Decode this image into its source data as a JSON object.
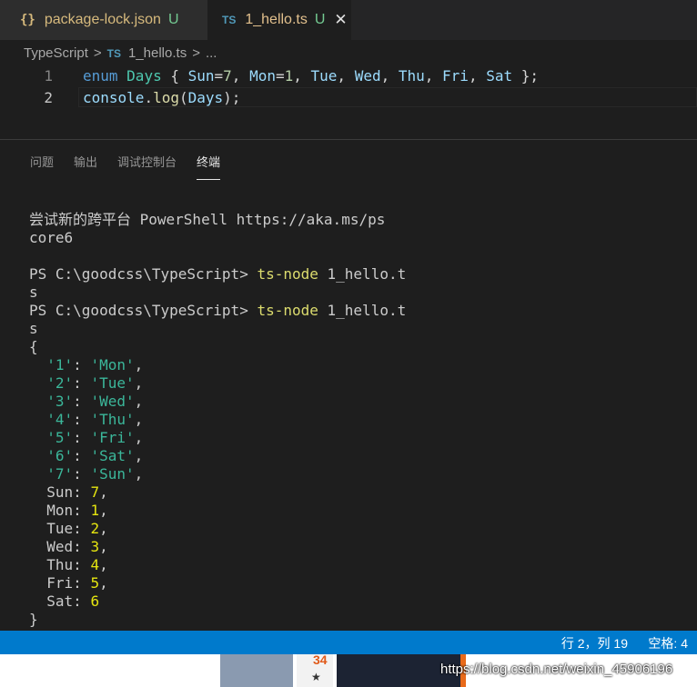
{
  "tabs": [
    {
      "icon_text": "{}",
      "icon": "json-icon",
      "label": "package-lock.json",
      "status": "U"
    },
    {
      "icon_text": "TS",
      "icon": "typescript-icon",
      "label": "1_hello.ts",
      "status": "U",
      "close": "✕"
    }
  ],
  "breadcrumb": {
    "folder": "TypeScript",
    "sep": ">",
    "ts_icon": "TS",
    "file": "1_hello.ts",
    "more": "..."
  },
  "editor": {
    "lines": [
      {
        "number": "1",
        "tokens": [
          {
            "t": "enum",
            "c": "kw"
          },
          {
            "t": " ",
            "c": "pn"
          },
          {
            "t": "Days",
            "c": "ty"
          },
          {
            "t": " { ",
            "c": "pn"
          },
          {
            "t": "Sun",
            "c": "vr"
          },
          {
            "t": "=",
            "c": "pn"
          },
          {
            "t": "7",
            "c": "nm"
          },
          {
            "t": ", ",
            "c": "pn"
          },
          {
            "t": "Mon",
            "c": "vr"
          },
          {
            "t": "=",
            "c": "pn"
          },
          {
            "t": "1",
            "c": "nm"
          },
          {
            "t": ", ",
            "c": "pn"
          },
          {
            "t": "Tue",
            "c": "vr"
          },
          {
            "t": ", ",
            "c": "pn"
          },
          {
            "t": "Wed",
            "c": "vr"
          },
          {
            "t": ", ",
            "c": "pn"
          },
          {
            "t": "Thu",
            "c": "vr"
          },
          {
            "t": ", ",
            "c": "pn"
          },
          {
            "t": "Fri",
            "c": "vr"
          },
          {
            "t": ", ",
            "c": "pn"
          },
          {
            "t": "Sat",
            "c": "vr"
          },
          {
            "t": " };",
            "c": "pn"
          }
        ]
      },
      {
        "number": "2",
        "tokens": [
          {
            "t": "console",
            "c": "vr"
          },
          {
            "t": ".",
            "c": "pn"
          },
          {
            "t": "log",
            "c": "fn"
          },
          {
            "t": "(",
            "c": "pn"
          },
          {
            "t": "Days",
            "c": "vr"
          },
          {
            "t": ");",
            "c": "pn"
          }
        ]
      }
    ]
  },
  "panel_tabs": [
    "问题",
    "输出",
    "调试控制台",
    "终端"
  ],
  "panel_active_tab": "终端",
  "terminal": {
    "lines": [
      [
        {
          "t": "尝试新的跨平台 PowerShell https://aka.ms/ps",
          "c": ""
        }
      ],
      [
        {
          "t": "core6",
          "c": ""
        }
      ],
      [
        {
          "t": "",
          "c": ""
        }
      ],
      [
        {
          "t": "PS C:\\goodcss\\TypeScript> ",
          "c": ""
        },
        {
          "t": "ts-node",
          "c": "cmd"
        },
        {
          "t": " 1_hello.t",
          "c": ""
        }
      ],
      [
        {
          "t": "s",
          "c": ""
        }
      ],
      [
        {
          "t": "PS C:\\goodcss\\TypeScript> ",
          "c": ""
        },
        {
          "t": "ts-node",
          "c": "cmd"
        },
        {
          "t": " 1_hello.t",
          "c": ""
        }
      ],
      [
        {
          "t": "s",
          "c": ""
        }
      ],
      [
        {
          "t": "{",
          "c": ""
        }
      ],
      [
        {
          "t": "  ",
          "c": ""
        },
        {
          "t": "'1'",
          "c": "str"
        },
        {
          "t": ": ",
          "c": ""
        },
        {
          "t": "'Mon'",
          "c": "str"
        },
        {
          "t": ",",
          "c": ""
        }
      ],
      [
        {
          "t": "  ",
          "c": ""
        },
        {
          "t": "'2'",
          "c": "str"
        },
        {
          "t": ": ",
          "c": ""
        },
        {
          "t": "'Tue'",
          "c": "str"
        },
        {
          "t": ",",
          "c": ""
        }
      ],
      [
        {
          "t": "  ",
          "c": ""
        },
        {
          "t": "'3'",
          "c": "str"
        },
        {
          "t": ": ",
          "c": ""
        },
        {
          "t": "'Wed'",
          "c": "str"
        },
        {
          "t": ",",
          "c": ""
        }
      ],
      [
        {
          "t": "  ",
          "c": ""
        },
        {
          "t": "'4'",
          "c": "str"
        },
        {
          "t": ": ",
          "c": ""
        },
        {
          "t": "'Thu'",
          "c": "str"
        },
        {
          "t": ",",
          "c": ""
        }
      ],
      [
        {
          "t": "  ",
          "c": ""
        },
        {
          "t": "'5'",
          "c": "str"
        },
        {
          "t": ": ",
          "c": ""
        },
        {
          "t": "'Fri'",
          "c": "str"
        },
        {
          "t": ",",
          "c": ""
        }
      ],
      [
        {
          "t": "  ",
          "c": ""
        },
        {
          "t": "'6'",
          "c": "str"
        },
        {
          "t": ": ",
          "c": ""
        },
        {
          "t": "'Sat'",
          "c": "str"
        },
        {
          "t": ",",
          "c": ""
        }
      ],
      [
        {
          "t": "  ",
          "c": ""
        },
        {
          "t": "'7'",
          "c": "str"
        },
        {
          "t": ": ",
          "c": ""
        },
        {
          "t": "'Sun'",
          "c": "str"
        },
        {
          "t": ",",
          "c": ""
        }
      ],
      [
        {
          "t": "  Sun: ",
          "c": ""
        },
        {
          "t": "7",
          "c": "num"
        },
        {
          "t": ",",
          "c": ""
        }
      ],
      [
        {
          "t": "  Mon: ",
          "c": ""
        },
        {
          "t": "1",
          "c": "num"
        },
        {
          "t": ",",
          "c": ""
        }
      ],
      [
        {
          "t": "  Tue: ",
          "c": ""
        },
        {
          "t": "2",
          "c": "num"
        },
        {
          "t": ",",
          "c": ""
        }
      ],
      [
        {
          "t": "  Wed: ",
          "c": ""
        },
        {
          "t": "3",
          "c": "num"
        },
        {
          "t": ",",
          "c": ""
        }
      ],
      [
        {
          "t": "  Thu: ",
          "c": ""
        },
        {
          "t": "4",
          "c": "num"
        },
        {
          "t": ",",
          "c": ""
        }
      ],
      [
        {
          "t": "  Fri: ",
          "c": ""
        },
        {
          "t": "5",
          "c": "num"
        },
        {
          "t": ",",
          "c": ""
        }
      ],
      [
        {
          "t": "  Sat: ",
          "c": ""
        },
        {
          "t": "6",
          "c": "num"
        }
      ],
      [
        {
          "t": "}",
          "c": ""
        }
      ]
    ]
  },
  "statusbar": {
    "position": "行 2，列 19",
    "spaces": "空格: 4"
  },
  "bottom_strip": {
    "number": "34",
    "star": "★",
    "watermark": "https://blog.csdn.net/weixin_45906196"
  },
  "colors": {
    "accent": "#007acc",
    "editor_bg": "#1e1e1e",
    "tab_bar": "#252526"
  }
}
